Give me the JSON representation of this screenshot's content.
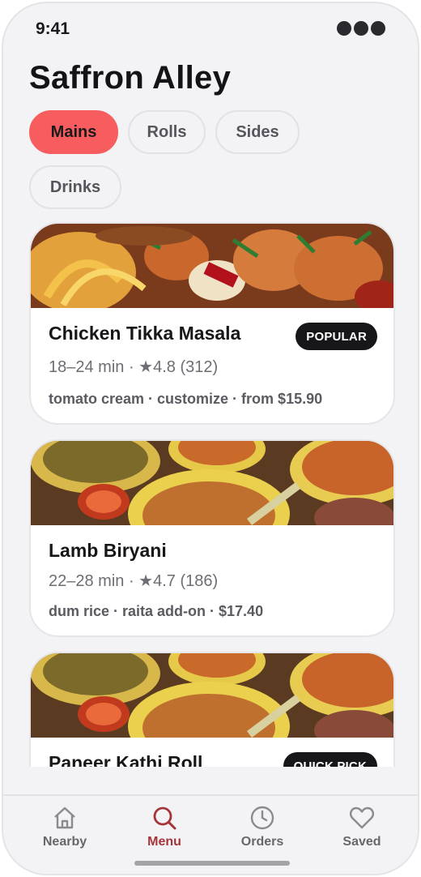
{
  "status": {
    "time": "9:41"
  },
  "app": {
    "title": "Saffron Alley"
  },
  "categories": [
    {
      "label": "Mains",
      "active": true
    },
    {
      "label": "Rolls",
      "active": false
    },
    {
      "label": "Sides",
      "active": false
    },
    {
      "label": "Drinks",
      "active": false
    }
  ],
  "menu_items": [
    {
      "name": "Chicken Tikka Masala",
      "meta": "18–24 min · ★4.8 (312)",
      "description": "tomato cream · customize · from $15.90",
      "badge": "POPULAR"
    },
    {
      "name": "Lamb Biryani",
      "meta": "22–28 min · ★4.7 (186)",
      "description": "dum rice · raita add-on · $17.40"
    },
    {
      "name": "Paneer Kathi Roll",
      "badge": "QUICK PICK"
    }
  ],
  "tabs": [
    {
      "label": "Nearby",
      "icon": "home-icon",
      "active": false
    },
    {
      "label": "Menu",
      "icon": "search-icon",
      "active": true
    },
    {
      "label": "Orders",
      "icon": "clock-icon",
      "active": false
    },
    {
      "label": "Saved",
      "icon": "heart-icon",
      "active": false
    }
  ],
  "colors": {
    "accent": "#f75c5f",
    "active_tab": "#a4343a",
    "badge_bg": "#17171a",
    "background": "#f3f3f5"
  }
}
